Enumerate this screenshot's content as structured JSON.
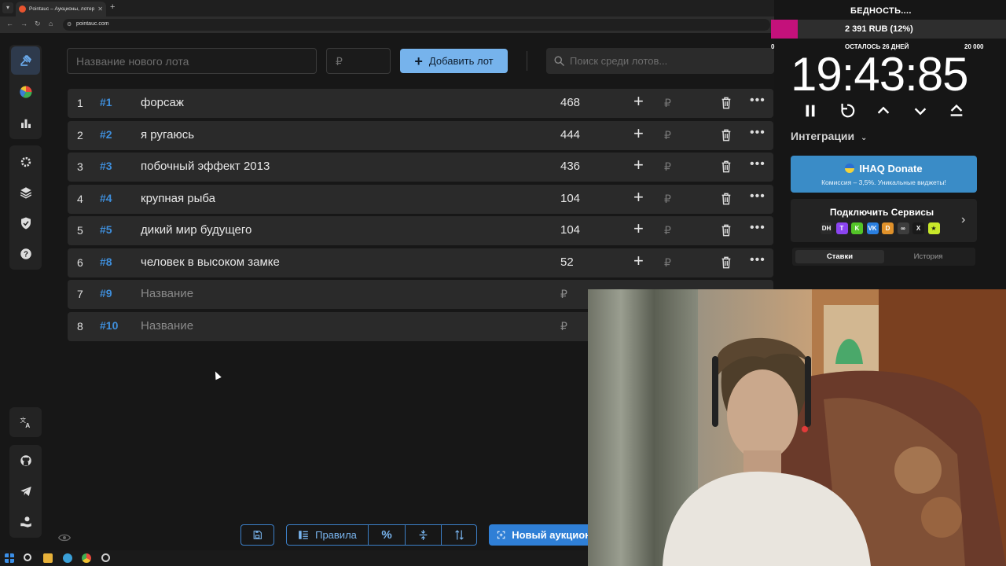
{
  "browser": {
    "tab_title": "Pointauc – Аукционы, лотереи",
    "url": "pointauc.com"
  },
  "sidebar": {
    "top_items": [
      "auction-icon",
      "pie-chart-icon",
      "bar-chart-icon"
    ],
    "mid_items": [
      "gear-icon",
      "layers-icon",
      "shield-icon",
      "help-icon"
    ],
    "bottom_items": [
      "translate-icon",
      "github-icon",
      "telegram-icon",
      "donate-hand-icon"
    ]
  },
  "new_lot": {
    "name_placeholder": "Название нового лота",
    "sum_placeholder": "₽",
    "add_label": "Добавить лот"
  },
  "search": {
    "placeholder": "Поиск среди лотов..."
  },
  "lots": [
    {
      "index": "1",
      "id": "#1",
      "name": "форсаж",
      "amount": "468"
    },
    {
      "index": "2",
      "id": "#2",
      "name": "я ругаюсь",
      "amount": "444"
    },
    {
      "index": "3",
      "id": "#3",
      "name": "побочный эффект 2013",
      "amount": "436"
    },
    {
      "index": "4",
      "id": "#4",
      "name": "крупная рыба",
      "amount": "104"
    },
    {
      "index": "5",
      "id": "#5",
      "name": "дикий мир будущего",
      "amount": "104"
    },
    {
      "index": "6",
      "id": "#8",
      "name": "человек в высоком замке",
      "amount": "52"
    },
    {
      "index": "7",
      "id": "#9",
      "name": "Название",
      "amount": ""
    },
    {
      "index": "8",
      "id": "#10",
      "name": "Название",
      "amount": ""
    }
  ],
  "currency_symbol": "₽",
  "bottom_toolbar": {
    "rules_label": "Правила",
    "new_auction_label": "Новый аукцион"
  },
  "goal": {
    "title": "БЕДНОСТЬ....",
    "progress_text": "2 391 RUB (12%)",
    "progress_fraction": 0.12,
    "min_label": "0",
    "remaining_label": "ОСТАЛОСЬ 26 ДНЕЙ",
    "max_label": "20 000",
    "fill_color": "#c4117b"
  },
  "timer": {
    "value": "19:43:85"
  },
  "integrations": {
    "label": "Интеграции",
    "donate_title": "IHAQ Donate",
    "donate_subtitle": "Комиссия – 3,5%. Уникальные виджеты!",
    "services_title": "Подключить Сервисы",
    "services": [
      "DH",
      "T",
      "K",
      "VK",
      "D",
      "∞",
      "X",
      "★"
    ]
  },
  "history_tabs": {
    "bets": "Ставки",
    "history": "История"
  },
  "colors": {
    "accent": "#3f8fdc",
    "add_button": "#76b3ec",
    "donate": "#3a8cc7"
  }
}
